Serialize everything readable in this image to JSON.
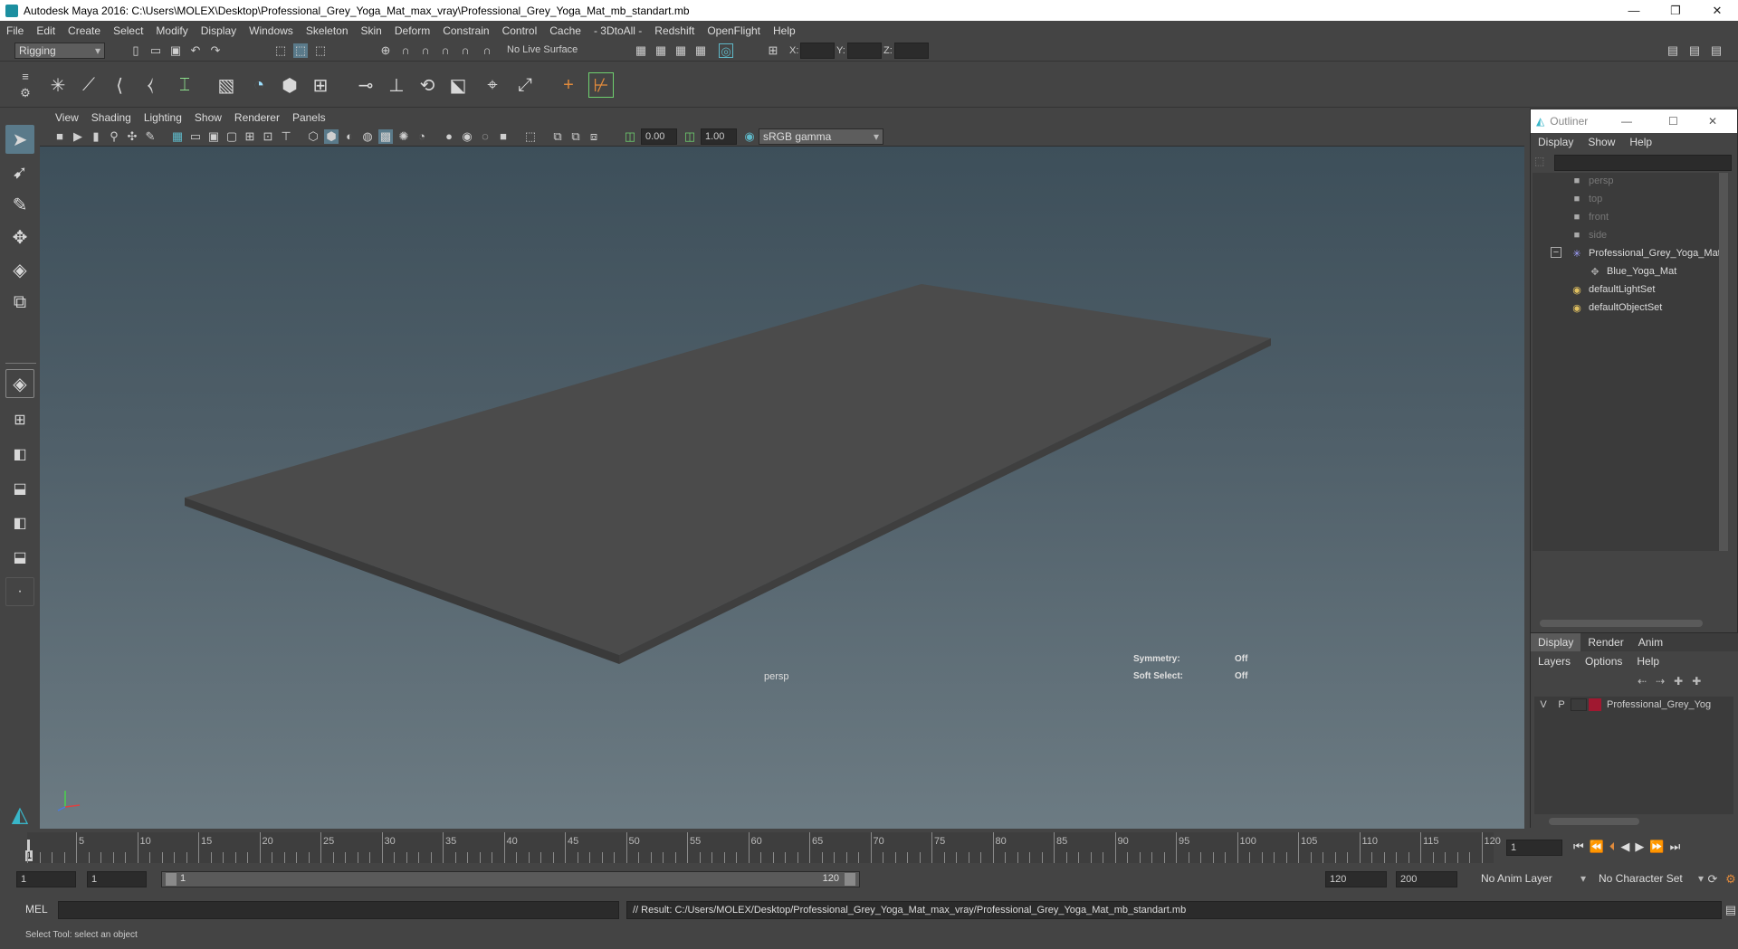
{
  "window": {
    "title": "Autodesk Maya 2016: C:\\Users\\MOLEX\\Desktop\\Professional_Grey_Yoga_Mat_max_vray\\Professional_Grey_Yoga_Mat_mb_standart.mb",
    "buttons": [
      "—",
      "❐",
      "✕"
    ]
  },
  "menubar": [
    "File",
    "Edit",
    "Create",
    "Select",
    "Modify",
    "Display",
    "Windows",
    "Skeleton",
    "Skin",
    "Deform",
    "Constrain",
    "Control",
    "Cache",
    "- 3DtoAll -",
    "Redshift",
    "OpenFlight",
    "Help"
  ],
  "statusline": {
    "menuset": "Rigging",
    "live_surface": "No Live Surface",
    "x_label": "X:",
    "y_label": "Y:",
    "z_label": "Z:"
  },
  "panel": {
    "menu": [
      "View",
      "Shading",
      "Lighting",
      "Show",
      "Renderer",
      "Panels"
    ],
    "exposure": "0.00",
    "gamma": "1.00",
    "colorspace": "sRGB gamma",
    "camera": "persp",
    "hud": {
      "symmetry_label": "Symmetry:",
      "symmetry_value": "Off",
      "softselect_label": "Soft Select:",
      "softselect_value": "Off"
    }
  },
  "outliner": {
    "title": "Outliner",
    "menu": [
      "Display",
      "Show",
      "Help"
    ],
    "items": [
      {
        "label": "persp",
        "icon": "camera-icon",
        "dim": true
      },
      {
        "label": "top",
        "icon": "camera-icon",
        "dim": true
      },
      {
        "label": "front",
        "icon": "camera-icon",
        "dim": true
      },
      {
        "label": "side",
        "icon": "camera-icon",
        "dim": true
      },
      {
        "label": "Professional_Grey_Yoga_Mat",
        "icon": "group-icon",
        "dim": false
      },
      {
        "label": "Blue_Yoga_Mat",
        "icon": "mesh-icon",
        "dim": false
      },
      {
        "label": "defaultLightSet",
        "icon": "set-icon",
        "dim": false
      },
      {
        "label": "defaultObjectSet",
        "icon": "set-icon",
        "dim": false
      }
    ]
  },
  "layers": {
    "tabs": [
      "Display",
      "Render",
      "Anim"
    ],
    "menu": [
      "Layers",
      "Options",
      "Help"
    ],
    "row": {
      "v": "V",
      "p": "P",
      "name": "Professional_Grey_Yog",
      "color": "#a01830"
    }
  },
  "timeline": {
    "ticks": [
      "5",
      "10",
      "15",
      "20",
      "25",
      "30",
      "35",
      "40",
      "45",
      "50",
      "55",
      "60",
      "65",
      "70",
      "75",
      "80",
      "85",
      "90",
      "95",
      "100",
      "105",
      "110",
      "115",
      "120"
    ],
    "current_frame_marker": "1",
    "current_frame_field": "1"
  },
  "range": {
    "start": "1",
    "playback_start": "1",
    "slider_start": "1",
    "slider_end": "120",
    "playback_end": "120",
    "end": "200",
    "anim_layer": "No Anim Layer",
    "char_set": "No Character Set"
  },
  "cmdline": {
    "lang": "MEL",
    "result": "// Result: C:/Users/MOLEX/Desktop/Professional_Grey_Yoga_Mat_max_vray/Professional_Grey_Yoga_Mat_mb_standart.mb"
  },
  "helpline": "Select Tool: select an object",
  "colors": {
    "accent": "#5fb8c8",
    "viewport_top": "#3d4f5a",
    "viewport_bottom": "#6c7b83",
    "mat": "#4a4a4a",
    "layer": "#a01830"
  }
}
